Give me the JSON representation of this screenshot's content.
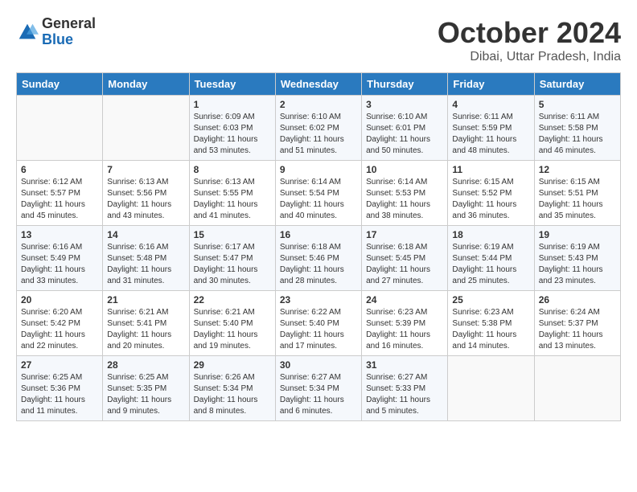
{
  "header": {
    "logo": {
      "general": "General",
      "blue": "Blue"
    },
    "title": "October 2024",
    "location": "Dibai, Uttar Pradesh, India"
  },
  "weekdays": [
    "Sunday",
    "Monday",
    "Tuesday",
    "Wednesday",
    "Thursday",
    "Friday",
    "Saturday"
  ],
  "weeks": [
    [
      {
        "day": "",
        "sunrise": "",
        "sunset": "",
        "daylight": ""
      },
      {
        "day": "",
        "sunrise": "",
        "sunset": "",
        "daylight": ""
      },
      {
        "day": "1",
        "sunrise": "Sunrise: 6:09 AM",
        "sunset": "Sunset: 6:03 PM",
        "daylight": "Daylight: 11 hours and 53 minutes."
      },
      {
        "day": "2",
        "sunrise": "Sunrise: 6:10 AM",
        "sunset": "Sunset: 6:02 PM",
        "daylight": "Daylight: 11 hours and 51 minutes."
      },
      {
        "day": "3",
        "sunrise": "Sunrise: 6:10 AM",
        "sunset": "Sunset: 6:01 PM",
        "daylight": "Daylight: 11 hours and 50 minutes."
      },
      {
        "day": "4",
        "sunrise": "Sunrise: 6:11 AM",
        "sunset": "Sunset: 5:59 PM",
        "daylight": "Daylight: 11 hours and 48 minutes."
      },
      {
        "day": "5",
        "sunrise": "Sunrise: 6:11 AM",
        "sunset": "Sunset: 5:58 PM",
        "daylight": "Daylight: 11 hours and 46 minutes."
      }
    ],
    [
      {
        "day": "6",
        "sunrise": "Sunrise: 6:12 AM",
        "sunset": "Sunset: 5:57 PM",
        "daylight": "Daylight: 11 hours and 45 minutes."
      },
      {
        "day": "7",
        "sunrise": "Sunrise: 6:13 AM",
        "sunset": "Sunset: 5:56 PM",
        "daylight": "Daylight: 11 hours and 43 minutes."
      },
      {
        "day": "8",
        "sunrise": "Sunrise: 6:13 AM",
        "sunset": "Sunset: 5:55 PM",
        "daylight": "Daylight: 11 hours and 41 minutes."
      },
      {
        "day": "9",
        "sunrise": "Sunrise: 6:14 AM",
        "sunset": "Sunset: 5:54 PM",
        "daylight": "Daylight: 11 hours and 40 minutes."
      },
      {
        "day": "10",
        "sunrise": "Sunrise: 6:14 AM",
        "sunset": "Sunset: 5:53 PM",
        "daylight": "Daylight: 11 hours and 38 minutes."
      },
      {
        "day": "11",
        "sunrise": "Sunrise: 6:15 AM",
        "sunset": "Sunset: 5:52 PM",
        "daylight": "Daylight: 11 hours and 36 minutes."
      },
      {
        "day": "12",
        "sunrise": "Sunrise: 6:15 AM",
        "sunset": "Sunset: 5:51 PM",
        "daylight": "Daylight: 11 hours and 35 minutes."
      }
    ],
    [
      {
        "day": "13",
        "sunrise": "Sunrise: 6:16 AM",
        "sunset": "Sunset: 5:49 PM",
        "daylight": "Daylight: 11 hours and 33 minutes."
      },
      {
        "day": "14",
        "sunrise": "Sunrise: 6:16 AM",
        "sunset": "Sunset: 5:48 PM",
        "daylight": "Daylight: 11 hours and 31 minutes."
      },
      {
        "day": "15",
        "sunrise": "Sunrise: 6:17 AM",
        "sunset": "Sunset: 5:47 PM",
        "daylight": "Daylight: 11 hours and 30 minutes."
      },
      {
        "day": "16",
        "sunrise": "Sunrise: 6:18 AM",
        "sunset": "Sunset: 5:46 PM",
        "daylight": "Daylight: 11 hours and 28 minutes."
      },
      {
        "day": "17",
        "sunrise": "Sunrise: 6:18 AM",
        "sunset": "Sunset: 5:45 PM",
        "daylight": "Daylight: 11 hours and 27 minutes."
      },
      {
        "day": "18",
        "sunrise": "Sunrise: 6:19 AM",
        "sunset": "Sunset: 5:44 PM",
        "daylight": "Daylight: 11 hours and 25 minutes."
      },
      {
        "day": "19",
        "sunrise": "Sunrise: 6:19 AM",
        "sunset": "Sunset: 5:43 PM",
        "daylight": "Daylight: 11 hours and 23 minutes."
      }
    ],
    [
      {
        "day": "20",
        "sunrise": "Sunrise: 6:20 AM",
        "sunset": "Sunset: 5:42 PM",
        "daylight": "Daylight: 11 hours and 22 minutes."
      },
      {
        "day": "21",
        "sunrise": "Sunrise: 6:21 AM",
        "sunset": "Sunset: 5:41 PM",
        "daylight": "Daylight: 11 hours and 20 minutes."
      },
      {
        "day": "22",
        "sunrise": "Sunrise: 6:21 AM",
        "sunset": "Sunset: 5:40 PM",
        "daylight": "Daylight: 11 hours and 19 minutes."
      },
      {
        "day": "23",
        "sunrise": "Sunrise: 6:22 AM",
        "sunset": "Sunset: 5:40 PM",
        "daylight": "Daylight: 11 hours and 17 minutes."
      },
      {
        "day": "24",
        "sunrise": "Sunrise: 6:23 AM",
        "sunset": "Sunset: 5:39 PM",
        "daylight": "Daylight: 11 hours and 16 minutes."
      },
      {
        "day": "25",
        "sunrise": "Sunrise: 6:23 AM",
        "sunset": "Sunset: 5:38 PM",
        "daylight": "Daylight: 11 hours and 14 minutes."
      },
      {
        "day": "26",
        "sunrise": "Sunrise: 6:24 AM",
        "sunset": "Sunset: 5:37 PM",
        "daylight": "Daylight: 11 hours and 13 minutes."
      }
    ],
    [
      {
        "day": "27",
        "sunrise": "Sunrise: 6:25 AM",
        "sunset": "Sunset: 5:36 PM",
        "daylight": "Daylight: 11 hours and 11 minutes."
      },
      {
        "day": "28",
        "sunrise": "Sunrise: 6:25 AM",
        "sunset": "Sunset: 5:35 PM",
        "daylight": "Daylight: 11 hours and 9 minutes."
      },
      {
        "day": "29",
        "sunrise": "Sunrise: 6:26 AM",
        "sunset": "Sunset: 5:34 PM",
        "daylight": "Daylight: 11 hours and 8 minutes."
      },
      {
        "day": "30",
        "sunrise": "Sunrise: 6:27 AM",
        "sunset": "Sunset: 5:34 PM",
        "daylight": "Daylight: 11 hours and 6 minutes."
      },
      {
        "day": "31",
        "sunrise": "Sunrise: 6:27 AM",
        "sunset": "Sunset: 5:33 PM",
        "daylight": "Daylight: 11 hours and 5 minutes."
      },
      {
        "day": "",
        "sunrise": "",
        "sunset": "",
        "daylight": ""
      },
      {
        "day": "",
        "sunrise": "",
        "sunset": "",
        "daylight": ""
      }
    ]
  ]
}
